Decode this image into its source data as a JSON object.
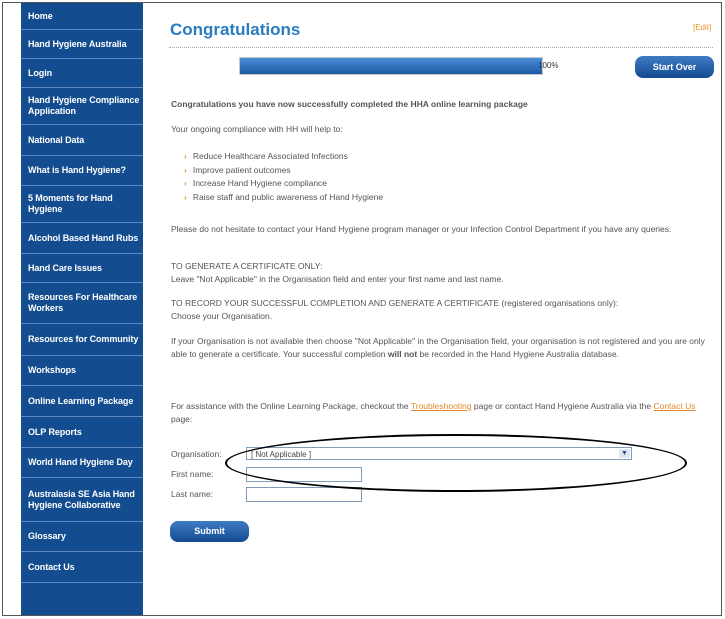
{
  "sidebar": {
    "items": [
      {
        "label": "Home"
      },
      {
        "label": "Hand Hygiene Australia"
      },
      {
        "label": "Login"
      },
      {
        "label": "Hand Hygiene Compliance Application"
      },
      {
        "label": "National Data"
      },
      {
        "label": "What is Hand Hygiene?"
      },
      {
        "label": "5 Moments for Hand Hygiene"
      },
      {
        "label": "Alcohol Based Hand Rubs"
      },
      {
        "label": "Hand Care Issues"
      },
      {
        "label": "Resources For Healthcare Workers"
      },
      {
        "label": "Resources for Community"
      },
      {
        "label": "Workshops"
      },
      {
        "label": "Online Learning Package"
      },
      {
        "label": "OLP Reports"
      },
      {
        "label": "World Hand Hygiene Day"
      },
      {
        "label": "Australasia SE Asia Hand Hygiene Collaborative"
      },
      {
        "label": "Glossary"
      },
      {
        "label": "Contact Us"
      }
    ]
  },
  "main": {
    "title": "Congratulations",
    "edit_label": "[Edit]",
    "progress": {
      "value": 1.0,
      "label": "100%"
    },
    "start_over_label": "Start Over",
    "heading": "Congratulations you have now successfully completed the HHA online learning package",
    "intro": "Your ongoing compliance with HH will help to:",
    "bullets": [
      "Reduce Healthcare Associated Infections",
      "Improve patient outcomes",
      "Increase Hand Hygiene compliance",
      "Raise staff and public awareness of Hand Hygiene"
    ],
    "contact_text": "Please do not hesitate to contact your Hand Hygiene program manager or your Infection Control Department if you have any queries.",
    "cert_only_1": "TO GENERATE A CERTIFICATE ONLY:",
    "cert_only_2": "Leave \"Not Applicable\" in the Organisation field and enter your first name and last name.",
    "record_1": "TO RECORD YOUR SUCCESSFUL COMPLETION AND GENERATE A CERTIFICATE (registered organisations only):",
    "record_2": "Choose your Organisation.",
    "org_note_a": "If your Organisation is not available then choose \"Not Applicable\" in the Organisation field, your organisation is not registered and you are only able to generate a certificate. Your successful completion ",
    "org_note_bold": "will not",
    "org_note_b": " be recorded in the Hand Hygiene Australia database.",
    "assist_a": "For assistance with the Online Learning Package, checkout the ",
    "assist_link1": "Troubleshooting",
    "assist_b": " page or contact Hand Hygiene Australia via the ",
    "assist_link2": "Contact Us",
    "assist_c": " page:",
    "form": {
      "organisation_label": "Organisation:",
      "organisation_value": "[ Not Applicable ]",
      "first_name_label": "First name:",
      "first_name_value": "",
      "last_name_label": "Last name:",
      "last_name_value": ""
    },
    "submit_label": "Submit"
  },
  "colors": {
    "sidebar": "#134c8f",
    "title": "#2a7cc0",
    "link": "#e08a2a",
    "button": "#134b91"
  }
}
